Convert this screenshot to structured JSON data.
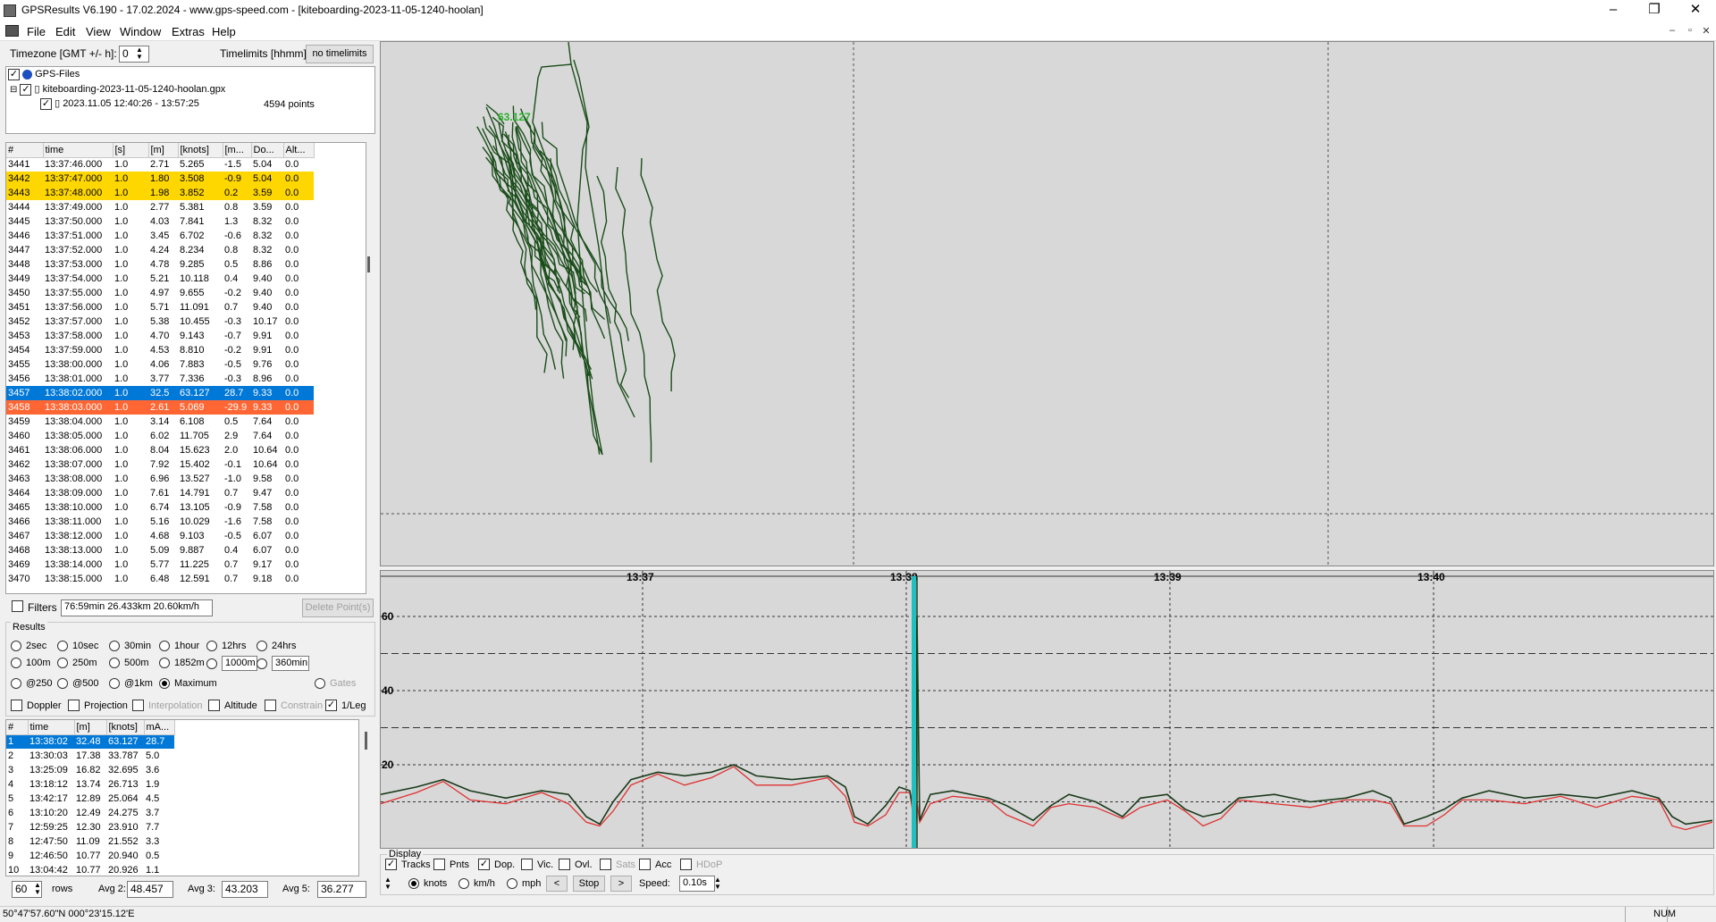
{
  "window": {
    "title": "GPSResults V6.190 - 17.02.2024 - www.gps-speed.com - [kiteboarding-2023-11-05-1240-hoolan]",
    "controls": [
      "–",
      "❐",
      "✕"
    ]
  },
  "menu": [
    "File",
    "Edit",
    "View",
    "Window",
    "Extras",
    "Help"
  ],
  "mdi_controls": [
    "–",
    "▫",
    "✕"
  ],
  "timezone": {
    "label": "Timezone [GMT +/- h]:",
    "value": "0"
  },
  "timelimits": {
    "label": "Timelimits [hhmm]:",
    "button": "no timelimits"
  },
  "tree": {
    "root": "GPS-Files",
    "file": "kiteboarding-2023-11-05-1240-hoolan.gpx",
    "session": "2023.11.05 12:40:26 - 13:57:25",
    "points": "4594 points"
  },
  "data_table": {
    "columns": [
      "#",
      "time",
      "[s]",
      "[m]",
      "[knots]",
      "[m...",
      "Do...",
      "Alt..."
    ],
    "rows": [
      [
        "3441",
        "13:37:46.000",
        "1.0",
        "2.71",
        "5.265",
        "-1.5",
        "5.04",
        "0.0"
      ],
      [
        "3442",
        "13:37:47.000",
        "1.0",
        "1.80",
        "3.508",
        "-0.9",
        "5.04",
        "0.0"
      ],
      [
        "3443",
        "13:37:48.000",
        "1.0",
        "1.98",
        "3.852",
        "0.2",
        "3.59",
        "0.0"
      ],
      [
        "3444",
        "13:37:49.000",
        "1.0",
        "2.77",
        "5.381",
        "0.8",
        "3.59",
        "0.0"
      ],
      [
        "3445",
        "13:37:50.000",
        "1.0",
        "4.03",
        "7.841",
        "1.3",
        "8.32",
        "0.0"
      ],
      [
        "3446",
        "13:37:51.000",
        "1.0",
        "3.45",
        "6.702",
        "-0.6",
        "8.32",
        "0.0"
      ],
      [
        "3447",
        "13:37:52.000",
        "1.0",
        "4.24",
        "8.234",
        "0.8",
        "8.32",
        "0.0"
      ],
      [
        "3448",
        "13:37:53.000",
        "1.0",
        "4.78",
        "9.285",
        "0.5",
        "8.86",
        "0.0"
      ],
      [
        "3449",
        "13:37:54.000",
        "1.0",
        "5.21",
        "10.118",
        "0.4",
        "9.40",
        "0.0"
      ],
      [
        "3450",
        "13:37:55.000",
        "1.0",
        "4.97",
        "9.655",
        "-0.2",
        "9.40",
        "0.0"
      ],
      [
        "3451",
        "13:37:56.000",
        "1.0",
        "5.71",
        "11.091",
        "0.7",
        "9.40",
        "0.0"
      ],
      [
        "3452",
        "13:37:57.000",
        "1.0",
        "5.38",
        "10.455",
        "-0.3",
        "10.17",
        "0.0"
      ],
      [
        "3453",
        "13:37:58.000",
        "1.0",
        "4.70",
        "9.143",
        "-0.7",
        "9.91",
        "0.0"
      ],
      [
        "3454",
        "13:37:59.000",
        "1.0",
        "4.53",
        "8.810",
        "-0.2",
        "9.91",
        "0.0"
      ],
      [
        "3455",
        "13:38:00.000",
        "1.0",
        "4.06",
        "7.883",
        "-0.5",
        "9.76",
        "0.0"
      ],
      [
        "3456",
        "13:38:01.000",
        "1.0",
        "3.77",
        "7.336",
        "-0.3",
        "8.96",
        "0.0"
      ],
      [
        "3457",
        "13:38:02.000",
        "1.0",
        "32.5",
        "63.127",
        "28.7",
        "9.33",
        "0.0"
      ],
      [
        "3458",
        "13:38:03.000",
        "1.0",
        "2.61",
        "5.069",
        "-29.9",
        "9.33",
        "0.0"
      ],
      [
        "3459",
        "13:38:04.000",
        "1.0",
        "3.14",
        "6.108",
        "0.5",
        "7.64",
        "0.0"
      ],
      [
        "3460",
        "13:38:05.000",
        "1.0",
        "6.02",
        "11.705",
        "2.9",
        "7.64",
        "0.0"
      ],
      [
        "3461",
        "13:38:06.000",
        "1.0",
        "8.04",
        "15.623",
        "2.0",
        "10.64",
        "0.0"
      ],
      [
        "3462",
        "13:38:07.000",
        "1.0",
        "7.92",
        "15.402",
        "-0.1",
        "10.64",
        "0.0"
      ],
      [
        "3463",
        "13:38:08.000",
        "1.0",
        "6.96",
        "13.527",
        "-1.0",
        "9.58",
        "0.0"
      ],
      [
        "3464",
        "13:38:09.000",
        "1.0",
        "7.61",
        "14.791",
        "0.7",
        "9.47",
        "0.0"
      ],
      [
        "3465",
        "13:38:10.000",
        "1.0",
        "6.74",
        "13.105",
        "-0.9",
        "7.58",
        "0.0"
      ],
      [
        "3466",
        "13:38:11.000",
        "1.0",
        "5.16",
        "10.029",
        "-1.6",
        "7.58",
        "0.0"
      ],
      [
        "3467",
        "13:38:12.000",
        "1.0",
        "4.68",
        "9.103",
        "-0.5",
        "6.07",
        "0.0"
      ],
      [
        "3468",
        "13:38:13.000",
        "1.0",
        "5.09",
        "9.887",
        "0.4",
        "6.07",
        "0.0"
      ],
      [
        "3469",
        "13:38:14.000",
        "1.0",
        "5.77",
        "11.225",
        "0.7",
        "9.17",
        "0.0"
      ],
      [
        "3470",
        "13:38:15.000",
        "1.0",
        "6.48",
        "12.591",
        "0.7",
        "9.18",
        "0.0"
      ]
    ],
    "highlight": {
      "1": "yellow",
      "2": "yellow",
      "16": "blue",
      "17": "orange"
    }
  },
  "filters": {
    "label": "Filters",
    "value": "76:59min 26.433km 20.60km/h",
    "delete": "Delete Point(s)"
  },
  "results": {
    "title": "Results",
    "radio_row1": [
      "2sec",
      "10sec",
      "30min",
      "1hour",
      "12hrs",
      "24hrs"
    ],
    "radio_row2": [
      "100m",
      "250m",
      "500m",
      "1852m"
    ],
    "field_1000": "1000m",
    "field_360": "360min",
    "radio_row3": [
      "@250",
      "@500",
      "@1km",
      "Maximum"
    ],
    "gates": "Gates",
    "selected": "Maximum",
    "checks": [
      {
        "label": "Doppler",
        "checked": false,
        "disabled": false
      },
      {
        "label": "Projection",
        "checked": false,
        "disabled": false
      },
      {
        "label": "Interpolation",
        "checked": false,
        "disabled": true
      },
      {
        "label": "Altitude",
        "checked": false,
        "disabled": false
      },
      {
        "label": "Constrain",
        "checked": false,
        "disabled": true
      },
      {
        "label": "1/Leg",
        "checked": true,
        "disabled": false
      }
    ]
  },
  "result_table": {
    "columns": [
      "#",
      "time",
      "[m]",
      "[knots]",
      "mA..."
    ],
    "rows": [
      [
        "1",
        "13:38:02",
        "32.48",
        "63.127",
        "28.7"
      ],
      [
        "2",
        "13:30:03",
        "17.38",
        "33.787",
        "5.0"
      ],
      [
        "3",
        "13:25:09",
        "16.82",
        "32.695",
        "3.6"
      ],
      [
        "4",
        "13:18:12",
        "13.74",
        "26.713",
        "1.9"
      ],
      [
        "5",
        "13:42:17",
        "12.89",
        "25.064",
        "4.5"
      ],
      [
        "6",
        "13:10:20",
        "12.49",
        "24.275",
        "3.7"
      ],
      [
        "7",
        "12:59:25",
        "12.30",
        "23.910",
        "7.7"
      ],
      [
        "8",
        "12:47:50",
        "11.09",
        "21.552",
        "3.3"
      ],
      [
        "9",
        "12:46:50",
        "10.77",
        "20.940",
        "0.5"
      ],
      [
        "10",
        "13:04:42",
        "10.77",
        "20.926",
        "1.1"
      ]
    ]
  },
  "bottom": {
    "rows_value": "60",
    "rows_label": "rows",
    "avg2_label": "Avg 2:",
    "avg2": "48.457",
    "avg3_label": "Avg 3:",
    "avg3": "43.203",
    "avg5_label": "Avg 5:",
    "avg5": "36.277"
  },
  "track": {
    "label": "63.127",
    "color": "#1a4d1a",
    "label_color": "#2bb02b"
  },
  "speed_graph": {
    "time_labels": [
      "13:37",
      "13:38",
      "13:39",
      "13:40"
    ],
    "y_labels": [
      "60",
      "40",
      "20"
    ],
    "speed_color": "#1a3a1a",
    "doppler_color": "#e03030",
    "cursor_color": "#20c0c0"
  },
  "display": {
    "title": "Display",
    "checks": [
      {
        "label": "Tracks",
        "checked": true,
        "disabled": false
      },
      {
        "label": "Pnts",
        "checked": false,
        "disabled": false
      },
      {
        "label": "Dop.",
        "checked": true,
        "disabled": false
      },
      {
        "label": "Vic.",
        "checked": false,
        "disabled": false
      },
      {
        "label": "Ovl.",
        "checked": false,
        "disabled": false
      },
      {
        "label": "Sats",
        "checked": false,
        "disabled": true
      },
      {
        "label": "Acc",
        "checked": false,
        "disabled": false
      },
      {
        "label": "HDoP",
        "checked": false,
        "disabled": true
      }
    ],
    "units": [
      "knots",
      "km/h",
      "mph"
    ],
    "unit_selected": "knots",
    "prev": "<",
    "stop": "Stop",
    "next": ">",
    "speed_label": "Speed:",
    "speed_value": "0.10s"
  },
  "status": {
    "coords": "50°47'57.60\"N 000°23'15.12'E",
    "num": "NUM"
  }
}
